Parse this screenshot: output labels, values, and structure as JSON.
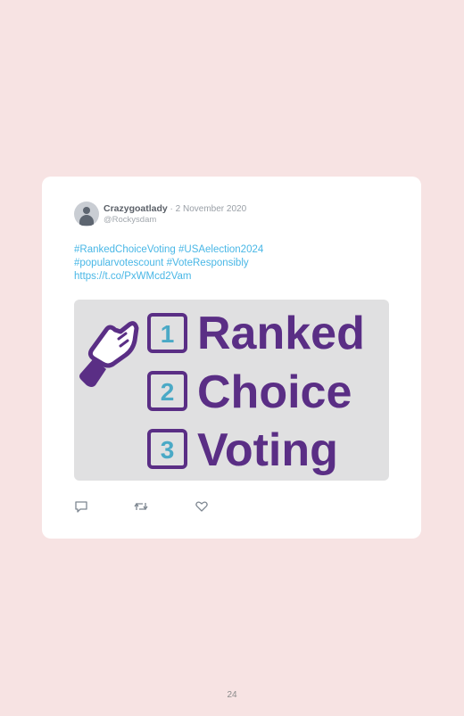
{
  "tweet": {
    "author_name": "Crazygoatlady",
    "separator": " · ",
    "date": "2 November 2020",
    "handle": "@Rockysdam",
    "text_lines": [
      "#RankedChoiceVoting #USAelection2024",
      "#popularvotescount #VoteResponsibly",
      "https://t.co/PxWMcd2Vam"
    ],
    "image": {
      "items": [
        {
          "number": "1",
          "word": "Ranked"
        },
        {
          "number": "2",
          "word": "Choice"
        },
        {
          "number": "3",
          "word": "Voting"
        }
      ],
      "colors": {
        "purple": "#5a2e85",
        "teal": "#4aa9c6",
        "background": "#e0e0e1"
      },
      "hand_icon": "pointing-hand-icon"
    },
    "actions": [
      {
        "icon": "reply-icon"
      },
      {
        "icon": "retweet-icon"
      },
      {
        "icon": "like-icon"
      }
    ]
  },
  "page_number": "24",
  "colors": {
    "page_background": "#f7e3e3",
    "link": "#49b7e6"
  }
}
